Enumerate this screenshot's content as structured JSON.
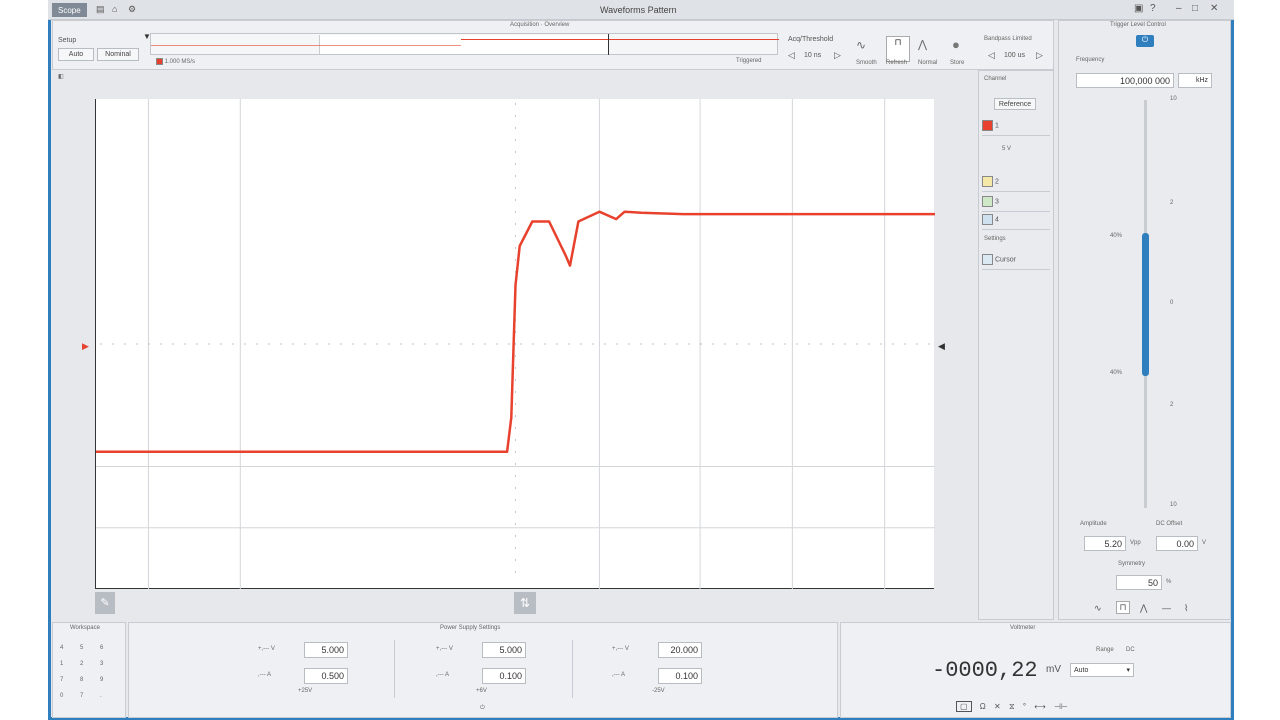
{
  "titlebar": {
    "tab": "Scope",
    "title": "Waveforms Pattern"
  },
  "setup": {
    "title": "Setup",
    "buttons": [
      "Auto",
      "Nominal"
    ]
  },
  "overview": {
    "title": "Acquisition · Overview",
    "rate": "1.000 MS/s",
    "state": "Triggered"
  },
  "controls": {
    "acq_title": "Acq/Threshold",
    "acq_value": "10 ns",
    "modes": [
      "Smooth",
      "Refresh",
      "Normal",
      "Store"
    ],
    "zoom_title": "Bandpass Limited",
    "zoom_value": "100 us"
  },
  "channels_panel": {
    "header": "Channel",
    "ref_button": "Reference",
    "ch_labels": [
      "1",
      "2",
      "3",
      "4"
    ],
    "ch1_ctrl": "5 V",
    "section": "Settings",
    "last": "Cursor"
  },
  "trigger_panel": {
    "title": "Trigger Level Control",
    "freq_label": "Frequency",
    "freq_value": "100,000 000",
    "freq_unit": "kHz",
    "scale_top": "10",
    "scale_bottom": "10",
    "scale_marks": [
      "2",
      "0",
      "2"
    ],
    "slider_top_label": "40%",
    "slider_bottom_label": "40%",
    "amp_label": "Amplitude",
    "offset_label": "DC Offset",
    "amp_value": "5.20",
    "amp_unit": "Vpp",
    "offset_value": "0.00",
    "offset_unit": "V",
    "sym_label": "Symmetry",
    "sym_value": "50",
    "sym_unit": "%",
    "shapes": [
      "∿",
      "⊓",
      "⋀",
      "—",
      "⌇"
    ]
  },
  "bottom": {
    "left_title": "Workspace",
    "mid_title": "Power Supply Settings",
    "right_title": "Voltmeter",
    "supplies": [
      {
        "v": "5.000",
        "a": "0.500",
        "name": "+25V"
      },
      {
        "v": "5.000",
        "a": "0.100",
        "name": "+6V"
      },
      {
        "v": "20.000",
        "a": "0.100",
        "name": "-25V"
      }
    ],
    "v_prefix": "+,--- V",
    "a_prefix": ",--- A",
    "reading": "-0000,22",
    "reading_unit": "mV",
    "range_label": "Range",
    "range_value": "Auto",
    "dc_label": "DC",
    "grid_keys": [
      "4",
      "5",
      "6",
      "1",
      "2",
      "3",
      "7",
      "8",
      "9",
      "0",
      "7",
      "."
    ]
  },
  "chart_data": {
    "type": "line",
    "series": [
      {
        "x": [
          0,
          0.49,
          0.495,
          0.5,
          0.505,
          0.52,
          0.54,
          0.56,
          0.565,
          0.575,
          0.6,
          0.62,
          0.63,
          0.65,
          0.7,
          0.8,
          0.9,
          1.0
        ],
        "values": [
          -2.2,
          -2.2,
          -1.5,
          1.2,
          2.0,
          2.5,
          2.5,
          1.8,
          1.6,
          2.5,
          2.7,
          2.55,
          2.7,
          2.68,
          2.65,
          2.65,
          2.65,
          2.65
        ],
        "color": "#e8422e"
      }
    ],
    "ylim": [
      -5,
      5
    ],
    "xlim": [
      0,
      1
    ],
    "grid": true
  }
}
